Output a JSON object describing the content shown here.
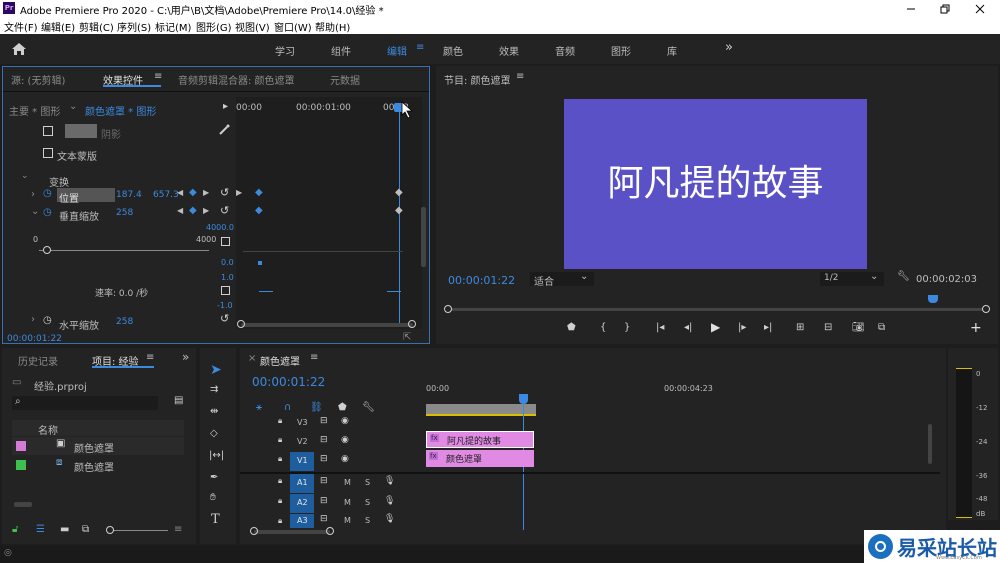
{
  "window": {
    "title": "Adobe Premiere Pro 2020 - C:\\用户\\B\\文档\\Adobe\\Premiere Pro\\14.0\\经验 *",
    "app_icon": "Pr"
  },
  "menu": [
    "文件(F)",
    "编辑(E)",
    "剪辑(C)",
    "序列(S)",
    "标记(M)",
    "图形(G)",
    "视图(V)",
    "窗口(W)",
    "帮助(H)"
  ],
  "workspaces": {
    "items": [
      "学习",
      "组件",
      "编辑",
      "颜色",
      "效果",
      "音频",
      "图形",
      "库"
    ],
    "active": "编辑"
  },
  "effect_panel": {
    "tabs": [
      "源: (无剪辑)",
      "效果控件",
      "音频剪辑混合器: 颜色遮罩",
      "元数据"
    ],
    "active_tab": "效果控件",
    "master": "主要 * 图形",
    "clip": "颜色遮罩 * 图形",
    "ruler": [
      "00:00",
      "00:00:01:00",
      "00:02"
    ],
    "shadow_label": "阴影",
    "text_mask_label": "文本蒙版",
    "transform_label": "变换",
    "position_label": "位置",
    "position_x": "187.4",
    "position_y": "657.3",
    "vscale_label": "垂直缩放",
    "vscale_value": "258",
    "scale_min": "0",
    "scale_max": "4000",
    "graph_top": "4000.0",
    "graph_zero": "0.0",
    "vel_top": "1.0",
    "vel_bottom": "-1.0",
    "rate_label": "速率: 0.0 /秒",
    "hscale_label": "水平缩放",
    "hscale_value": "258",
    "timecode": "00:00:01:22"
  },
  "program": {
    "title": "节目: 颜色遮罩",
    "frame_text": "阿凡提的故事",
    "frame_color": "#5b51c6",
    "timecode_left": "00:00:01:22",
    "fit": "适合",
    "resolution": "1/2",
    "timecode_right": "00:00:02:03"
  },
  "project": {
    "tabs": [
      "历史记录",
      "项目: 经验"
    ],
    "file": "经验.prproj",
    "search_placeholder": "",
    "col_name": "名称",
    "items": [
      {
        "name": "颜色遮罩",
        "swatch": "#d67ad8",
        "type": "image"
      },
      {
        "name": "颜色遮罩",
        "swatch": "#3fbf50",
        "type": "sequence"
      }
    ]
  },
  "timeline": {
    "title": "颜色遮罩",
    "timecode": "00:00:01:22",
    "ruler": [
      "00:00",
      "00:00:04:23"
    ],
    "video_tracks": [
      "V3",
      "V2",
      "V1"
    ],
    "audio_tracks": [
      "A1",
      "A2",
      "A3"
    ],
    "clips": [
      {
        "name": "阿凡提的故事",
        "track": "V2",
        "color": "#e08ae4"
      },
      {
        "name": "颜色遮罩",
        "track": "V1",
        "color": "#e08ae4"
      }
    ],
    "m_label": "M",
    "s_label": "S"
  },
  "meter": {
    "scale": [
      "0",
      "-12",
      "-24",
      "-36",
      "-48",
      "dB"
    ]
  },
  "watermark": {
    "text": "易采站长站",
    "sub": "Www.EasyCK.Com"
  },
  "colors": {
    "accent": "#3c8ae0",
    "keyframe": "#3c8ae0",
    "panel": "#232323"
  }
}
